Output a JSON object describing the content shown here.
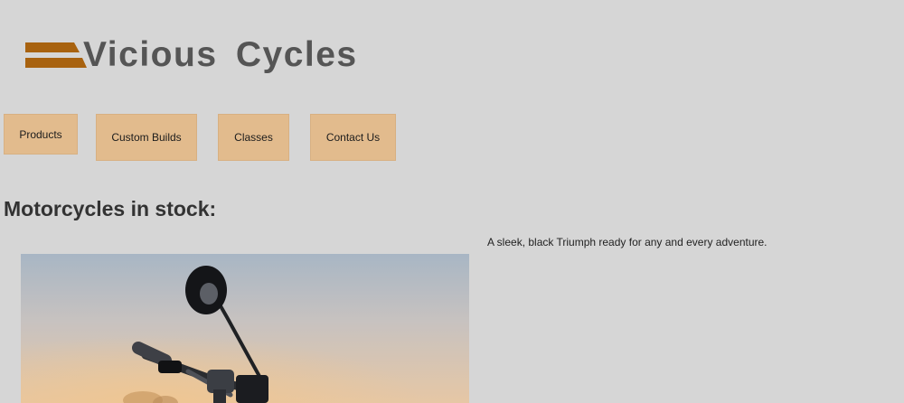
{
  "brand": {
    "name": "Vicious Cycles",
    "text_color": "#555555",
    "accent_color": "#a8620f"
  },
  "nav": {
    "items": [
      {
        "label": "Products"
      },
      {
        "label": "Custom Builds"
      },
      {
        "label": "Classes"
      },
      {
        "label": "Contact Us"
      }
    ],
    "button_color": "#e2bb8d"
  },
  "main": {
    "heading": "Motorcycles in stock:",
    "listings": [
      {
        "image": "motorcycle-handlebar-photo",
        "caption": "A sleek, black Triumph ready for any and every adventure."
      }
    ]
  },
  "page": {
    "background": "#d6d6d6"
  }
}
